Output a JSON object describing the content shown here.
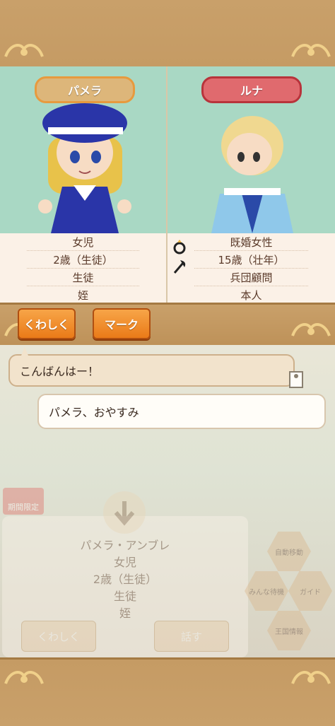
{
  "left_character": {
    "name": "パメラ",
    "info": [
      "女児",
      "2歳（生徒）",
      "生徒",
      "姪"
    ]
  },
  "right_character": {
    "name": "ルナ",
    "info": [
      "既婚女性",
      "15歳（壮年）",
      "兵団顧問",
      "本人"
    ]
  },
  "buttons": {
    "details": "くわしく",
    "mark": "マーク"
  },
  "chat": {
    "message_1": "こんばんはー！",
    "message_2": "パメラ、おやすみ"
  },
  "background_panel": {
    "limited_badge": "期間限定",
    "name": "パメラ・アンブレ",
    "info": [
      "女児",
      "2歳（生徒）",
      "生徒",
      "姪"
    ],
    "details_button": "くわしく",
    "talk_button": "話す"
  },
  "background_menu": {
    "auto_label": "自動移動",
    "guide_label": "ガイド",
    "friend_label": "みんな待機",
    "book_label": "王国情報"
  },
  "colors": {
    "frame": "#c9a06a",
    "portrait_bg": "#a9d8c4",
    "accent_orange": "#ea7a18",
    "pill_red": "#e06a6e"
  }
}
